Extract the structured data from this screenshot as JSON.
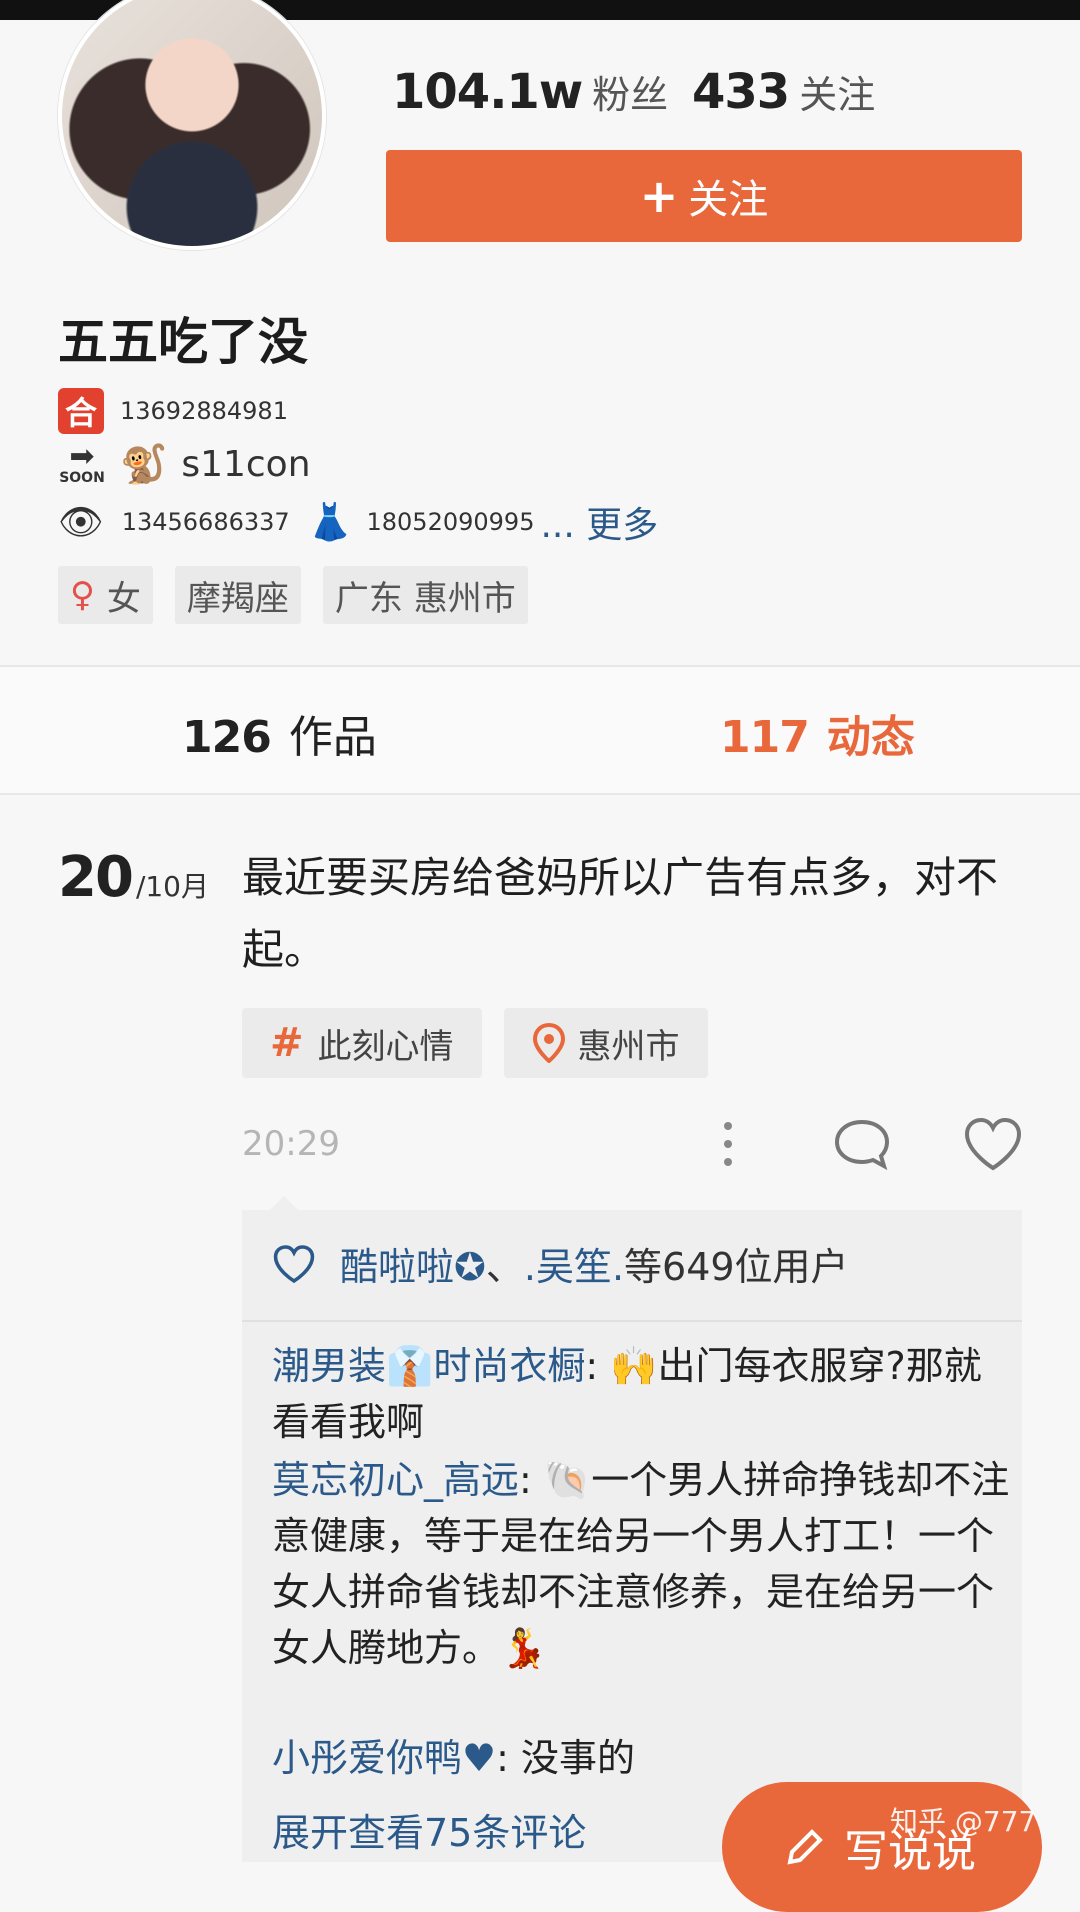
{
  "profile": {
    "fans_count": "104.1w",
    "fans_label": "粉丝",
    "following_count": "433",
    "following_label": "关注",
    "follow_button": "关注",
    "name": "五五吃了没",
    "bio": {
      "line1_badge": "合",
      "line1_text": "13692884981",
      "line2_text": "s11con",
      "line3_text1": "13456686337",
      "line3_text2": "18052090995",
      "more": "... 更多"
    },
    "tags": [
      "女",
      "摩羯座",
      "广东 惠州市"
    ]
  },
  "tabs": [
    {
      "count": "126",
      "label": "作品",
      "active": false
    },
    {
      "count": "117",
      "label": "动态",
      "active": true
    }
  ],
  "post": {
    "day": "20",
    "month": "/10月",
    "text": "最近要买房给爸妈所以广告有点多，对不起。",
    "chips": [
      {
        "icon": "hash-icon",
        "label": "此刻心情"
      },
      {
        "icon": "location-pin-icon",
        "label": "惠州市"
      }
    ],
    "time": "20:29",
    "likes": {
      "user1": "酷啦啦✪",
      "sep": "、",
      "user2": ".吴笙.",
      "suffix": "等649位用户"
    },
    "comments": [
      {
        "author": "潮男装👔时尚衣橱",
        "text": "🙌出门每衣服穿?那就看看我啊"
      },
      {
        "author": "莫忘初心_高远",
        "text": "🐚一个男人拼命挣钱却不注意健康，等于是在给另一个男人打工！一个女人拼命省钱却不注意修养，是在给另一个女人腾地方。💃"
      },
      {
        "author": "小彤爱你鸭♥",
        "text": "没事的"
      }
    ],
    "expand": "展开查看75条评论"
  },
  "write_button": "写说说",
  "watermark": "知乎 @777",
  "colors": {
    "accent": "#e8683b",
    "link": "#2b5a8a"
  }
}
